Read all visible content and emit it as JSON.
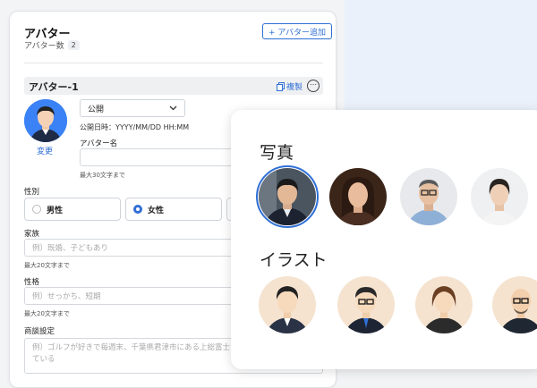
{
  "form": {
    "title": "アバター",
    "count_label": "アバター数",
    "count_value": "2",
    "add_button": "+ アバター追加",
    "avatar_header": "アバター-1",
    "duplicate_label": "複製",
    "more_icon": "⋯",
    "change_link": "変更",
    "status_select": "公開",
    "publish_date": "公開日時：YYYY/MM/DD HH:MM",
    "name_label": "アバター名",
    "name_hint": "最大30文字まで",
    "gender_label": "性別",
    "gender_options": [
      "男性",
      "女性"
    ],
    "gender_selected": "女性",
    "family_label": "家族",
    "family_placeholder": "例）既婚、子どもあり",
    "family_hint": "最大20文字まで",
    "personality_label": "性格",
    "personality_placeholder": "例）せっかち、短期",
    "personality_hint": "最大20文字まで",
    "talk_label": "商談設定",
    "talk_placeholder": "例）ゴルフが好きで毎週末、千葉県君津市にある上総富士ゴ",
    "talk_placeholder_2": "ている"
  },
  "picker": {
    "photo_title": "写真",
    "illust_title": "イラスト",
    "selected_index": 0
  },
  "icons": [
    "copy-icon",
    "more-icon",
    "chevron-down-icon",
    "plus-icon"
  ],
  "colors": {
    "accent": "#2f6fd6",
    "avatar_bg": "#3b82f6"
  }
}
